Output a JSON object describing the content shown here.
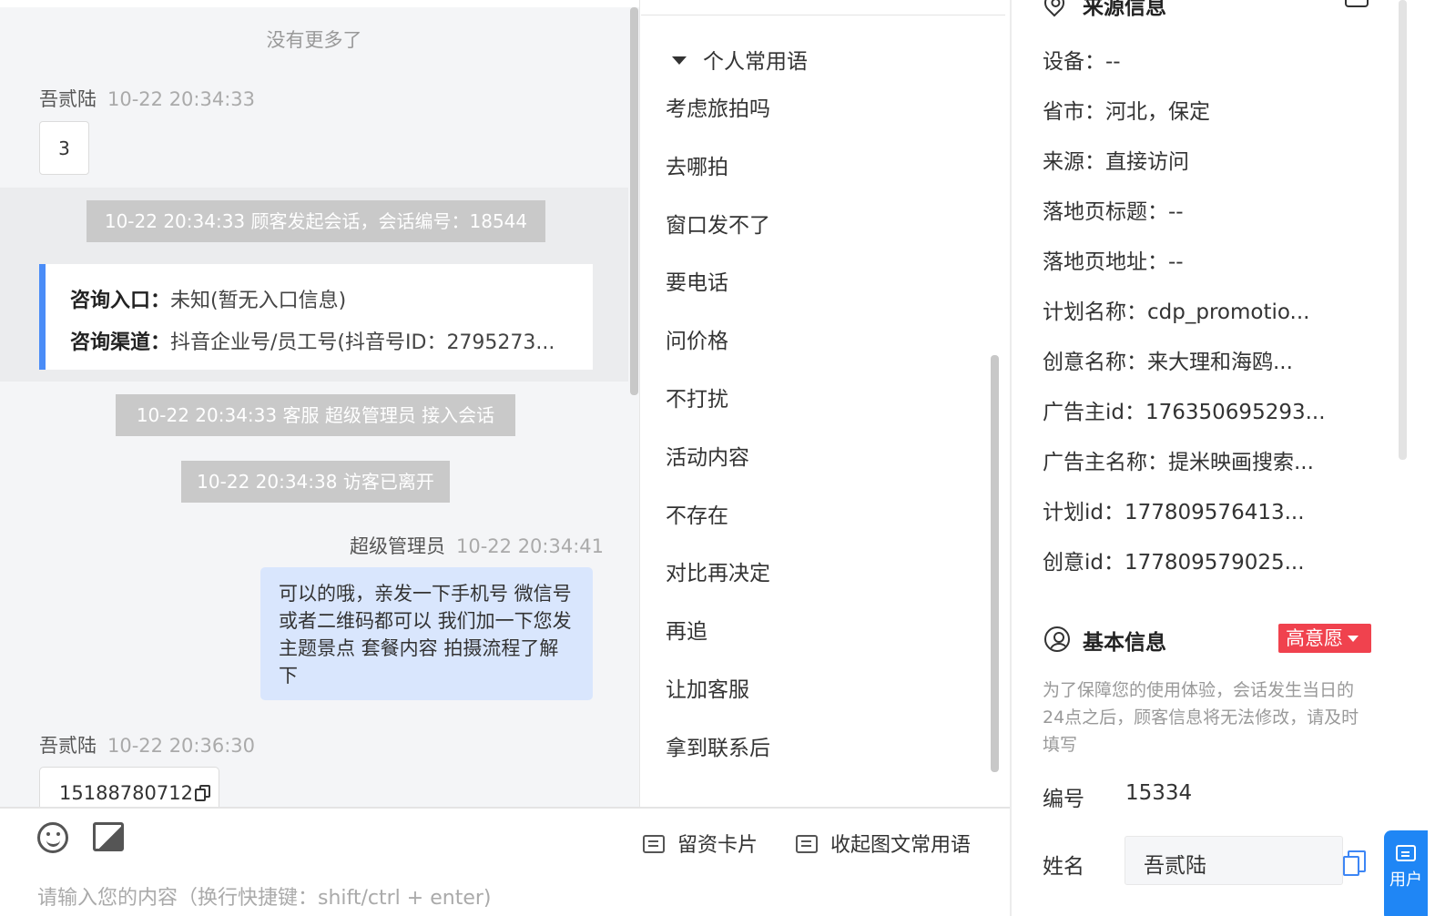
{
  "chat": {
    "no_more": "没有更多了",
    "messages": [
      {
        "sender": "吾贰陆",
        "time": "10-22 20:34:33",
        "content": "3"
      },
      {
        "sender": "超级管理员",
        "time": "10-22 20:34:41",
        "content": "可以的哦，亲发一下手机号 微信号或者二维码都可以 我们加一下您发主题景点 套餐内容 拍摄流程了解下"
      },
      {
        "sender": "吾贰陆",
        "time": "10-22 20:36:30",
        "content": "15188780712"
      }
    ],
    "system": {
      "session_start": "10-22 20:34:33 顾客发起会话，会话编号：18544",
      "agent_join": "10-22 20:34:33 客服 超级管理员 接入会话",
      "visitor_left": "10-22 20:34:38 访客已离开"
    },
    "entry": {
      "entry_label": "咨询入口：",
      "entry_value": "未知(暂无入口信息)",
      "channel_label": "咨询渠道：",
      "channel_value": "抖音企业号/员工号(抖音号ID：2795273..."
    }
  },
  "phrases": {
    "group_title": "个人常用语",
    "items": [
      "考虑旅拍吗",
      "去哪拍",
      "窗口发不了",
      "要电话",
      "问价格",
      "不打扰",
      "活动内容",
      "不存在",
      "对比再决定",
      "再追",
      "让加客服",
      "拿到联系后"
    ]
  },
  "source_info": {
    "title": "来源信息",
    "rows": [
      {
        "label": "设备：",
        "value": "--"
      },
      {
        "label": "省市：",
        "value": "河北，保定"
      },
      {
        "label": "来源：",
        "value": "直接访问"
      },
      {
        "label": "落地页标题：",
        "value": "--"
      },
      {
        "label": "落地页地址：",
        "value": "--"
      },
      {
        "label": "计划名称：",
        "value": "cdp_promotio..."
      },
      {
        "label": "创意名称：",
        "value": "来大理和海鸥..."
      },
      {
        "label": "广告主id：",
        "value": "176350695293..."
      },
      {
        "label": "广告主名称：",
        "value": "提米映画搜索..."
      },
      {
        "label": "计划id：",
        "value": "177809576413..."
      },
      {
        "label": "创意id：",
        "value": "177809579025..."
      }
    ]
  },
  "basic_info": {
    "title": "基本信息",
    "intent_badge": "高意愿",
    "notice": "为了保障您的使用体验，会话发生当日的24点之后，顾客信息将无法修改，请及时填写",
    "id_label": "编号",
    "id_value": "15334",
    "name_label": "姓名",
    "name_value": "吾贰陆"
  },
  "composer": {
    "lead_card": "留资卡片",
    "collapse_phrases": "收起图文常用语",
    "placeholder": "请输入您的内容（换行快捷键：shift/ctrl + enter)"
  },
  "float_button": {
    "label": "用户"
  },
  "colors": {
    "accent": "#1f86f5",
    "intent": "#f0424e",
    "agent_bubble": "#d9e6fd",
    "entry_bar": "#4a8cf7"
  }
}
